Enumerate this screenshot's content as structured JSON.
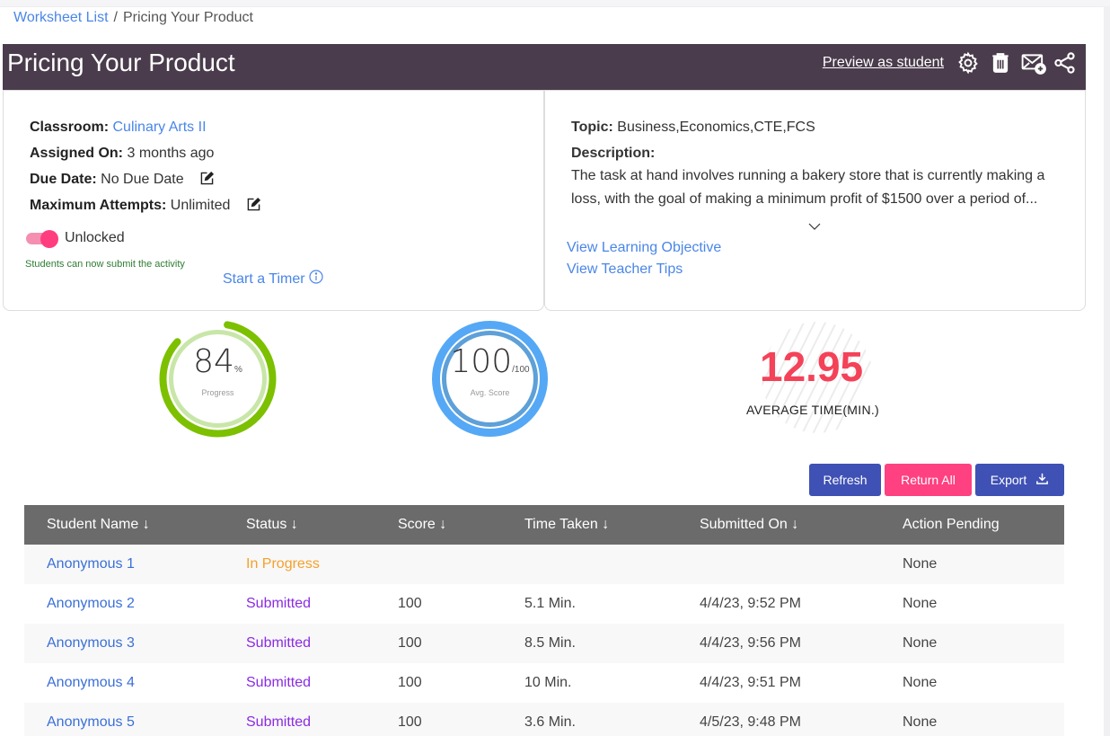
{
  "breadcrumb": {
    "parent": "Worksheet List",
    "separator": "/",
    "current": "Pricing Your Product"
  },
  "header": {
    "title": "Pricing Your Product",
    "preview_label": "Preview as student",
    "icons": [
      "gear-icon",
      "trash-icon",
      "mail-add-icon",
      "share-icon"
    ]
  },
  "details": {
    "classroom_label": "Classroom:",
    "classroom_value": "Culinary Arts II",
    "assigned_label": "Assigned On:",
    "assigned_value": "3 months ago",
    "due_label": "Due Date:",
    "due_value": "No Due Date",
    "attempts_label": "Maximum Attempts:",
    "attempts_value": "Unlimited",
    "lock_state": "Unlocked",
    "lock_on": true,
    "lock_hint": "Students can now submit the activity",
    "timer_label": "Start a Timer"
  },
  "info": {
    "topic_label": "Topic:",
    "topic_value": "Business,Economics,CTE,FCS",
    "description_label": "Description:",
    "description": "The task at hand involves running a bakery store that is currently making a loss, with the goal of making a minimum profit of $1500 over a period of...",
    "learning_objective_link": "View Learning Objective",
    "teacher_tips_link": "View Teacher Tips"
  },
  "stats": {
    "progress": {
      "value": "84",
      "suffix": "%",
      "label": "Progress",
      "fraction": 0.84,
      "color": "#7cc000",
      "inner_color": "#c8e6a8"
    },
    "avg_score": {
      "value": "100",
      "suffix": "/100",
      "label": "Avg. Score",
      "fraction": 1.0,
      "color": "#55a8f5",
      "inner_color": "#5ea0d8"
    },
    "avg_time": {
      "value": "12.95",
      "label": "AVERAGE TIME(MIN.)",
      "color": "#f44258"
    }
  },
  "buttons": {
    "refresh": "Refresh",
    "return_all": "Return All",
    "export": "Export"
  },
  "table": {
    "headers": [
      "Student Name ↓",
      "Status ↓",
      "Score ↓",
      "Time Taken ↓",
      "Submitted On ↓",
      "Action Pending"
    ],
    "rows": [
      {
        "name": "Anonymous 1",
        "status": "In Progress",
        "score": "",
        "time": "",
        "submitted": "",
        "action": "None"
      },
      {
        "name": "Anonymous 2",
        "status": "Submitted",
        "score": "100",
        "time": "5.1 Min.",
        "submitted": "4/4/23, 9:52 PM",
        "action": "None"
      },
      {
        "name": "Anonymous 3",
        "status": "Submitted",
        "score": "100",
        "time": "8.5 Min.",
        "submitted": "4/4/23, 9:56 PM",
        "action": "None"
      },
      {
        "name": "Anonymous 4",
        "status": "Submitted",
        "score": "100",
        "time": "10 Min.",
        "submitted": "4/4/23, 9:51 PM",
        "action": "None"
      },
      {
        "name": "Anonymous 5",
        "status": "Submitted",
        "score": "100",
        "time": "3.6 Min.",
        "submitted": "4/5/23, 9:48 PM",
        "action": "None"
      }
    ]
  }
}
